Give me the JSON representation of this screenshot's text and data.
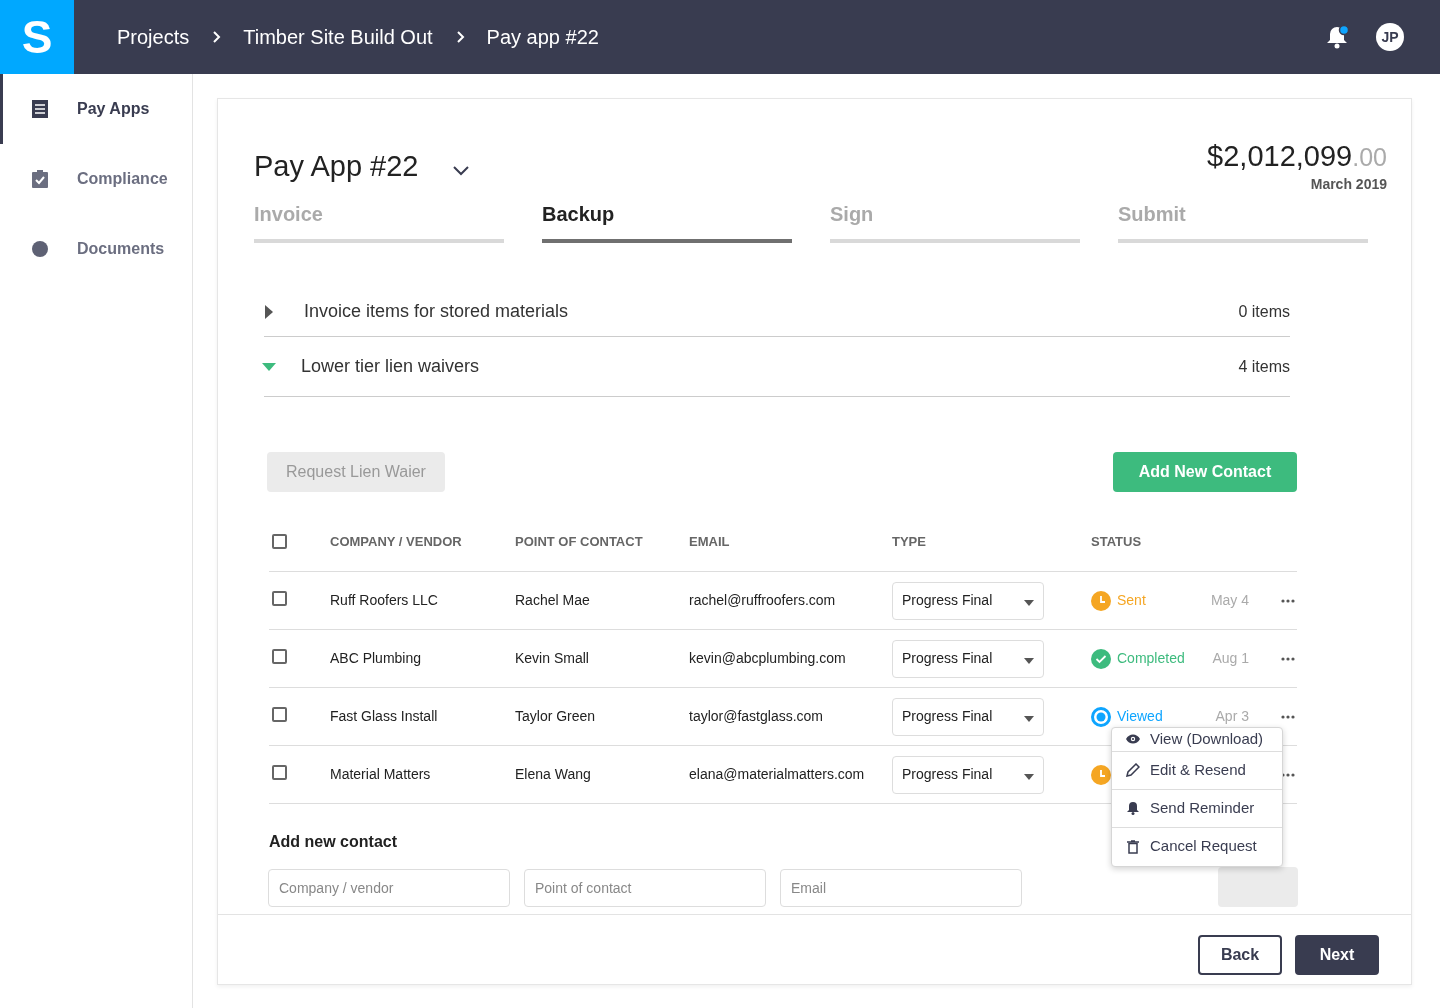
{
  "top_bar": {
    "logo": "S",
    "breadcrumbs": [
      "Projects",
      "Timber Site Build Out",
      "Pay app #22"
    ],
    "has_notification": true,
    "avatar": "JP"
  },
  "sidebar": {
    "items": [
      {
        "label": "Pay Apps",
        "selected": true,
        "kind": "list"
      },
      {
        "label": "Compliance",
        "selected": false,
        "kind": "clipboard"
      },
      {
        "label": "Documents",
        "selected": false,
        "kind": "dot"
      }
    ]
  },
  "header": {
    "title": "Pay App #22",
    "amount": "$2,012,099",
    "amount_cents": ".00",
    "date": "March 2019"
  },
  "steps": [
    {
      "label": "Invoice",
      "selected": false
    },
    {
      "label": "Backup",
      "selected": true
    },
    {
      "label": "Sign",
      "selected": false
    },
    {
      "label": "Submit",
      "selected": false
    }
  ],
  "sections": [
    {
      "title": "Invoice items for stored materials",
      "count": "0 items",
      "expanded": false
    },
    {
      "title": "Lower tier lien waivers",
      "count": "4 items",
      "expanded": true
    }
  ],
  "actions": {
    "request_button": {
      "label": "Request Lien Waier",
      "disabled": true
    },
    "add_button": {
      "label": "Add New Contact"
    }
  },
  "table": {
    "header_checked": false,
    "columns": [
      "COMPANY / VENDOR",
      "POINT OF CONTACT",
      "EMAIL",
      "TYPE",
      "STATUS"
    ],
    "rows": [
      {
        "checked": false,
        "company": "Ruff Roofers LLC",
        "contact": "Rachel Mae",
        "email": "rachel@ruffroofers.com",
        "type": "Progress Final",
        "status": {
          "kind": "sent",
          "label": "Sent"
        },
        "date": "May 4"
      },
      {
        "checked": false,
        "company": "ABC Plumbing",
        "contact": "Kevin Small",
        "email": "kevin@abcplumbing.com",
        "type": "Progress Final",
        "status": {
          "kind": "completed",
          "label": "Completed"
        },
        "date": "Aug 1"
      },
      {
        "checked": false,
        "company": "Fast Glass Install",
        "contact": "Taylor Green",
        "email": "taylor@fastglass.com",
        "type": "Progress Final",
        "status": {
          "kind": "viewed",
          "label": "Viewed"
        },
        "date": "Apr 3"
      },
      {
        "checked": false,
        "company": "Material Matters",
        "contact": "Elena Wang",
        "email": "elana@materialmatters.com",
        "type": "Progress Final",
        "status": {
          "kind": "sent"
        }
      }
    ]
  },
  "menu": {
    "items": [
      {
        "label": "View (Download)",
        "kind": "view"
      },
      {
        "label": "Edit & Resend",
        "kind": "edit"
      },
      {
        "label": "Send Reminder",
        "kind": "remind"
      },
      {
        "label": "Cancel Request",
        "kind": "cancel"
      }
    ]
  },
  "add_contact": {
    "title": "Add new contact",
    "fields": [
      {
        "placeholder": "Company / vendor"
      },
      {
        "placeholder": "Point of contact"
      },
      {
        "placeholder": "Email"
      }
    ],
    "button": {
      "disabled": true
    }
  },
  "footer": {
    "buttons": [
      {
        "label": "Back",
        "kind": "secondary"
      },
      {
        "label": "Next",
        "kind": "primary"
      }
    ]
  }
}
